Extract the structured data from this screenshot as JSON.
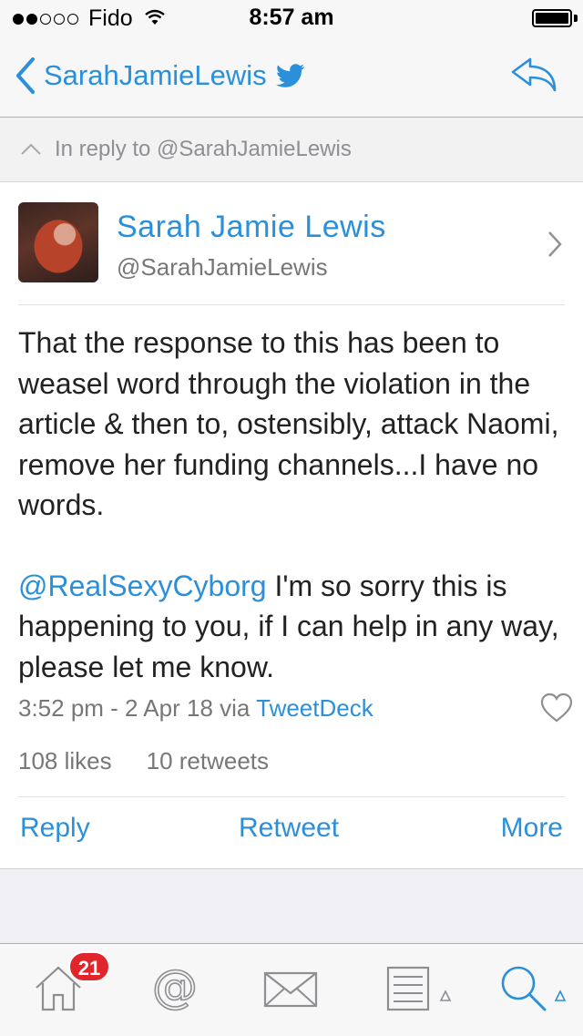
{
  "status_bar": {
    "carrier": "Fido",
    "time": "8:57 am",
    "signal_dots_filled": 2,
    "signal_dots_total": 5,
    "icons": [
      "wifi-icon",
      "battery-icon"
    ]
  },
  "nav": {
    "back_label": "SarahJamieLewis",
    "icons": [
      "chevron-left-icon",
      "twitter-bird-icon",
      "reply-arrow-icon"
    ]
  },
  "in_reply": {
    "text": "In reply to @SarahJamieLewis"
  },
  "tweet": {
    "name": "Sarah Jamie Lewis",
    "handle": "@SarahJamieLewis",
    "paragraph1": "That the response to this has been to weasel word through the violation in the article & then to, ostensibly, attack Naomi, remove her funding channels...I have no words.",
    "mention": "@RealSexyCyborg",
    "paragraph2_rest": " I'm so sorry this is happening to you, if I can help in any way, please let me know.",
    "timestamp": "3:52 pm - 2 Apr 18 via ",
    "source": "TweetDeck",
    "likes": "108 likes",
    "retweets": "10 retweets"
  },
  "actions": {
    "reply": "Reply",
    "retweet": "Retweet",
    "more": "More"
  },
  "tabbar": {
    "badge": "21",
    "tabs": [
      "home-icon",
      "mentions-icon",
      "messages-icon",
      "lists-icon",
      "search-icon"
    ]
  },
  "colors": {
    "accent": "#2b90d9",
    "badge": "#e0262a",
    "muted_text": "#777777"
  }
}
